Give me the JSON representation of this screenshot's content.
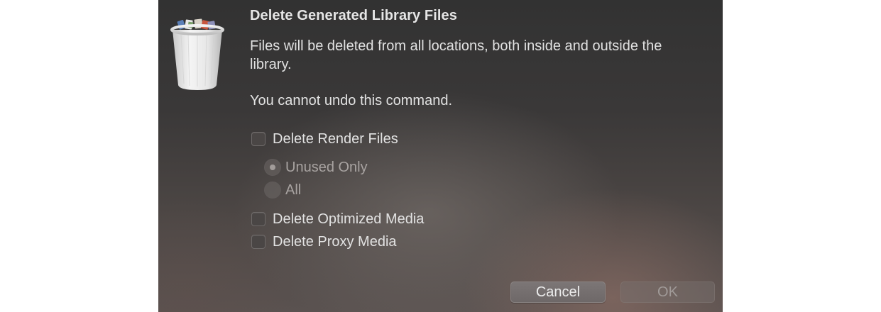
{
  "dialog": {
    "title": "Delete Generated Library Files",
    "message_line1": "Files will be deleted from all locations, both inside and outside the library.",
    "message_line2": "You cannot undo this command.",
    "icon": "trash-full-icon"
  },
  "options": {
    "render_files": {
      "label": "Delete Render Files",
      "checked": false
    },
    "render_radio": [
      {
        "label": "Unused Only",
        "selected": true,
        "enabled": false
      },
      {
        "label": "All",
        "selected": false,
        "enabled": false
      }
    ],
    "optimized_media": {
      "label": "Delete Optimized Media",
      "checked": false
    },
    "proxy_media": {
      "label": "Delete Proxy Media",
      "checked": false
    }
  },
  "buttons": {
    "cancel": "Cancel",
    "ok": "OK",
    "ok_enabled": false
  }
}
